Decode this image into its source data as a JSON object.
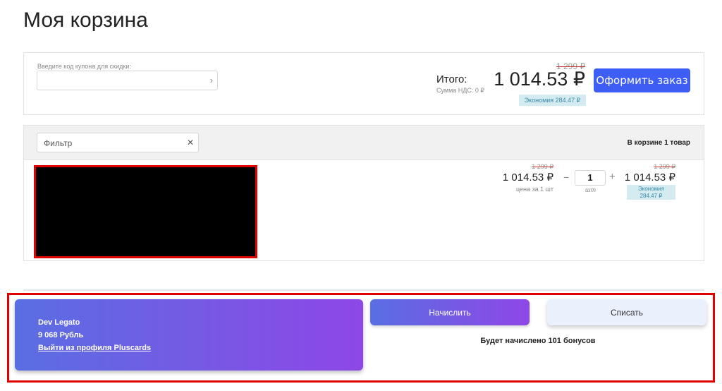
{
  "title": "Моя корзина",
  "coupon": {
    "label": "Введите код купона для скидки:",
    "value": "",
    "submit_icon": "chevron-right-icon"
  },
  "summary": {
    "total_label": "Итого:",
    "vat": "Сумма НДС: 0 ₽",
    "old_price": "1 299 ₽",
    "price": "1 014.53 ₽",
    "savings": "Экономия 284.47 ₽",
    "checkout": "Оформить заказ"
  },
  "cart": {
    "filter_placeholder": "Фильтр",
    "clear_icon": "close-icon",
    "count": "В корзине 1 товар",
    "item": {
      "old_price": "1 299 ₽",
      "price": "1 014.53 ₽",
      "price_note": "цена за 1 шт",
      "qty": "1",
      "unit": "шт",
      "minus": "−",
      "plus": "+",
      "total_old": "1 299 ₽",
      "total": "1 014.53 ₽",
      "savings_label": "Экономия",
      "savings_value": "284.47 ₽"
    }
  },
  "loyalty": {
    "name": "Dev Legato",
    "balance": "9 068 Рубль",
    "logout": "Выйти из профиля Pluscards",
    "accrue": "Начислить",
    "redeem": "Списать",
    "info": "Будет начислено 101 бонусов"
  },
  "colors": {
    "accent": "#3d5df5",
    "gradient_start": "#5a6ee3",
    "gradient_end": "#8e47e6",
    "highlight": "#e00000"
  }
}
